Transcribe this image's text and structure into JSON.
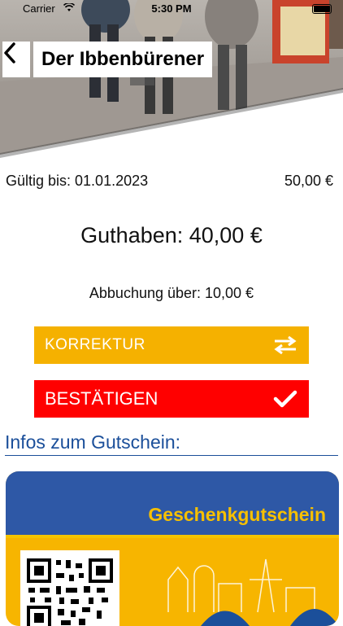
{
  "status_bar": {
    "carrier": "Carrier",
    "time": "5:30 PM"
  },
  "header": {
    "title": "Der Ibbenbürener",
    "back_icon": "chevron-left-icon"
  },
  "voucher_info": {
    "valid_until": "Gültig bis: 01.01.2023",
    "value": "50,00 €",
    "balance": "Guthaben: 40,00 €",
    "debit": "Abbuchung über: 10,00 €"
  },
  "buttons": {
    "korrektur": {
      "label": "KORREKTUR",
      "icon": "swap-arrows-icon",
      "color": "#f5b100"
    },
    "bestaetigen": {
      "label": "BESTÄTIGEN",
      "icon": "checkmark-icon",
      "color": "#ff0000"
    }
  },
  "infos": {
    "heading": "Infos zum Gutschein:"
  },
  "voucher_card": {
    "title": "Geschenkgutschein",
    "colors": {
      "primary": "#2e58a6",
      "accent": "#f7b500"
    }
  }
}
